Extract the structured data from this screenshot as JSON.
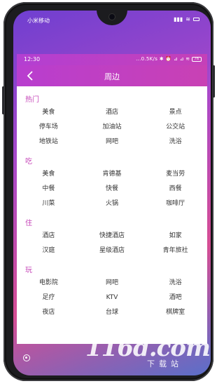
{
  "device": {
    "carrier": "小米移动",
    "watermark": "116d.com",
    "watermark_sub": "下载站"
  },
  "status": {
    "time": "12:30",
    "right": "...0.5K/s ✱ ⏰ ⊿ ⊿ ≋",
    "battery": "76"
  },
  "header": {
    "title": "周边",
    "back_icon": "chevron-left-icon"
  },
  "sections": [
    {
      "title": "热门",
      "items": [
        "美食",
        "酒店",
        "景点",
        "停车场",
        "加油站",
        "公交站",
        "地铁站",
        "网吧",
        "洗浴"
      ]
    },
    {
      "title": "吃",
      "items": [
        "美食",
        "肯德基",
        "麦当劳",
        "中餐",
        "快餐",
        "西餐",
        "川菜",
        "火锅",
        "咖啡厅"
      ]
    },
    {
      "title": "住",
      "items": [
        "酒店",
        "快捷酒店",
        "如家",
        "汉庭",
        "星级酒店",
        "青年旅社"
      ]
    },
    {
      "title": "玩",
      "items": [
        "电影院",
        "网吧",
        "洗浴",
        "足疗",
        "KTV",
        "酒吧",
        "夜店",
        "台球",
        "棋牌室"
      ]
    }
  ]
}
